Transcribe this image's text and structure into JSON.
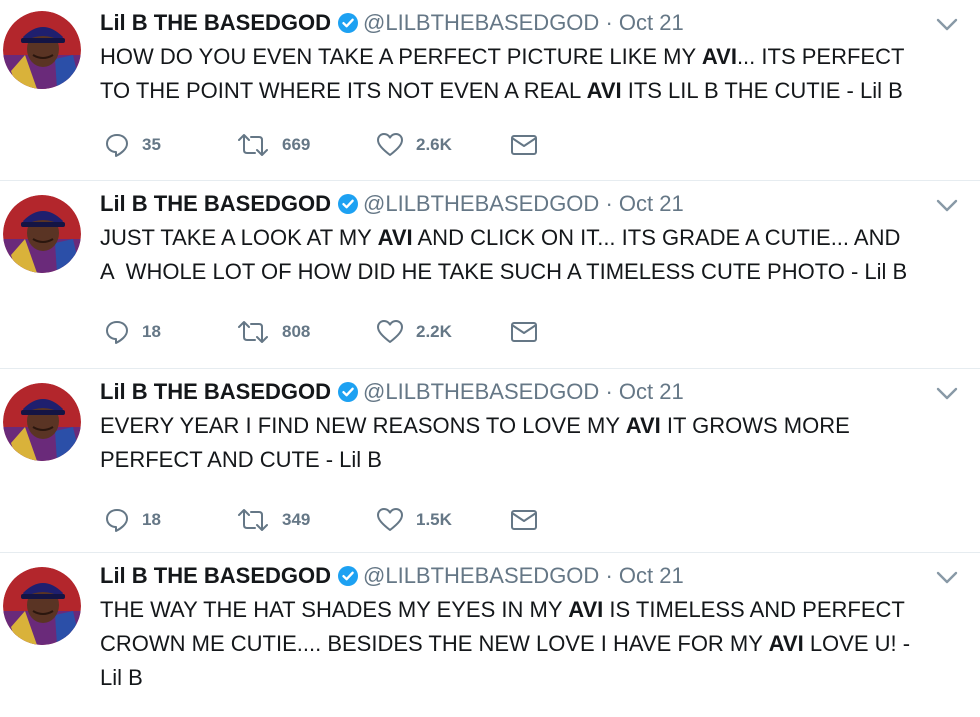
{
  "tweets": [
    {
      "name": "Lil B THE BASEDGOD",
      "handle": "@LILBTHEBASEDGOD",
      "separator": "·",
      "date": "Oct 21",
      "lines": [
        [
          {
            "t": "HOW DO YOU EVEN TAKE A PERFECT PICTURE LIKE MY ",
            "b": false
          },
          {
            "t": "AVI",
            "b": true
          },
          {
            "t": "... ITS PERFECT",
            "b": false
          }
        ],
        [
          {
            "t": "TO THE POINT WHERE ITS NOT EVEN A REAL ",
            "b": false
          },
          {
            "t": "AVI",
            "b": true
          },
          {
            "t": " ITS LIL B THE CUTIE - Lil B",
            "b": false
          }
        ]
      ],
      "replies": "35",
      "retweets": "669",
      "likes": "2.6K"
    },
    {
      "name": "Lil B THE BASEDGOD",
      "handle": "@LILBTHEBASEDGOD",
      "separator": "·",
      "date": "Oct 21",
      "lines": [
        [
          {
            "t": "JUST TAKE A LOOK AT MY ",
            "b": false
          },
          {
            "t": "AVI",
            "b": true
          },
          {
            "t": " AND CLICK ON IT... ITS GRADE A CUTIE... AND",
            "b": false
          }
        ],
        [
          {
            "t": "A  WHOLE LOT OF HOW DID HE TAKE SUCH A TIMELESS CUTE PHOTO - Lil B",
            "b": false
          }
        ]
      ],
      "replies": "18",
      "retweets": "808",
      "likes": "2.2K"
    },
    {
      "name": "Lil B THE BASEDGOD",
      "handle": "@LILBTHEBASEDGOD",
      "separator": "·",
      "date": "Oct 21",
      "lines": [
        [
          {
            "t": "EVERY YEAR I FIND NEW REASONS TO LOVE MY ",
            "b": false
          },
          {
            "t": "AVI",
            "b": true
          },
          {
            "t": " IT GROWS MORE",
            "b": false
          }
        ],
        [
          {
            "t": "PERFECT AND CUTE - Lil B",
            "b": false
          }
        ]
      ],
      "replies": "18",
      "retweets": "349",
      "likes": "1.5K"
    },
    {
      "name": "Lil B THE BASEDGOD",
      "handle": "@LILBTHEBASEDGOD",
      "separator": "·",
      "date": "Oct 21",
      "lines": [
        [
          {
            "t": "THE WAY THE HAT SHADES MY EYES IN MY ",
            "b": false
          },
          {
            "t": "AVI",
            "b": true
          },
          {
            "t": " IS TIMELESS AND PERFECT",
            "b": false
          }
        ],
        [
          {
            "t": "CROWN ME CUTIE.... BESIDES THE NEW LOVE I HAVE FOR MY ",
            "b": false
          },
          {
            "t": "AVI",
            "b": true
          },
          {
            "t": " LOVE U! -",
            "b": false
          }
        ],
        [
          {
            "t": "Lil B",
            "b": false
          }
        ]
      ]
    }
  ],
  "icons": {
    "verified": "verified-badge-icon",
    "caret": "chevron-down-icon",
    "reply": "reply-icon",
    "retweet": "retweet-icon",
    "like": "heart-icon",
    "message": "envelope-icon"
  },
  "colors": {
    "verified_blue": "#1da1f2",
    "secondary_text": "#657786",
    "primary_text": "#14171a",
    "divider": "#e6ecf0"
  }
}
